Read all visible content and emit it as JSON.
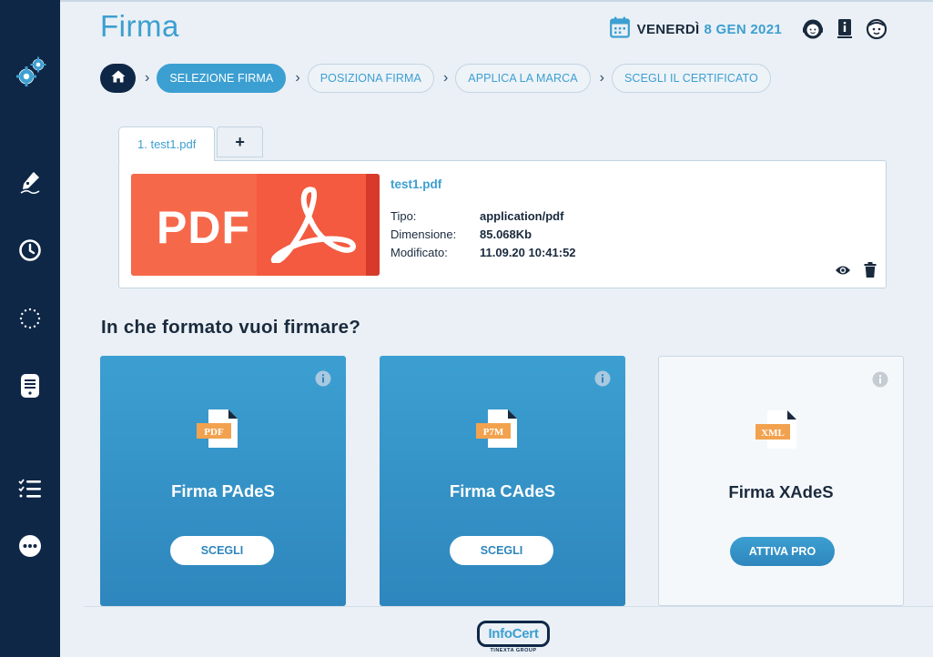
{
  "page": {
    "title": "Firma"
  },
  "header": {
    "day": "VENERDÌ",
    "date": "8 GEN 2021",
    "icons": [
      "calendar-icon",
      "support-agent-icon",
      "user-manual-icon",
      "profile-face-icon"
    ]
  },
  "breadcrumb": {
    "home_icon": "home-icon",
    "steps": [
      {
        "label": "SELEZIONE FIRMA",
        "active": true
      },
      {
        "label": "POSIZIONA FIRMA",
        "active": false
      },
      {
        "label": "APPLICA LA MARCA",
        "active": false
      },
      {
        "label": "SCEGLI IL CERTIFICATO",
        "active": false
      }
    ]
  },
  "sidebar": {
    "items": [
      "settings-gears-icon",
      "sign-pen-icon",
      "history-clock-icon",
      "loading-circle-icon",
      "document-list-icon",
      "tasks-list-icon",
      "more-options-icon"
    ]
  },
  "tabs": [
    {
      "label": "1. test1.pdf"
    },
    {
      "label": "+"
    }
  ],
  "file": {
    "thumb_text": "PDF",
    "name": "test1.pdf",
    "meta": [
      {
        "key": "Tipo:",
        "value": "application/pdf"
      },
      {
        "key": "Dimensione:",
        "value": "85.068Kb"
      },
      {
        "key": "Modificato:",
        "value": "11.09.20 10:41:52"
      }
    ]
  },
  "section": {
    "title": "In che formato vuoi firmare?"
  },
  "formats": [
    {
      "badge": "PDF",
      "label": "Firma PAdeS",
      "button": "SCEGLI"
    },
    {
      "badge": "P7M",
      "label": "Firma CAdeS",
      "button": "SCEGLI"
    },
    {
      "badge": "XML",
      "label": "Firma XAdeS",
      "button": "ATTIVA PRO"
    }
  ],
  "footer": {
    "logo_name": "InfoCert",
    "logo_sub": "TINEXTA GROUP"
  },
  "colors": {
    "brand_blue": "#3c9fd1",
    "navy": "#0f2747",
    "pdf_red": "#f35a3f"
  }
}
